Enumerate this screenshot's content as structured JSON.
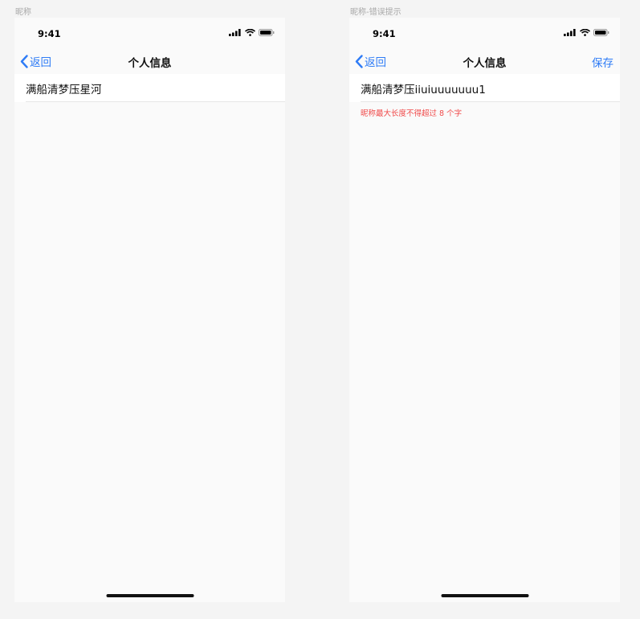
{
  "screens": [
    {
      "frame_label": "昵称",
      "status_time": "9:41",
      "nav": {
        "back_label": "返回",
        "title": "个人信息",
        "save_label": ""
      },
      "nickname_value": "满船清梦压星河",
      "error_message": ""
    },
    {
      "frame_label": "昵称-错误提示",
      "status_time": "9:41",
      "nav": {
        "back_label": "返回",
        "title": "个人信息",
        "save_label": "保存"
      },
      "nickname_value": "满船清梦压iiuiuuuuuuu1",
      "error_message": "昵称最大长度不得超过 8 个字"
    }
  ],
  "colors": {
    "accent": "#2f7cf6",
    "error": "#f04a4a"
  },
  "icons": [
    "cellular-signal-icon",
    "wifi-icon",
    "battery-icon",
    "chevron-left-icon"
  ]
}
